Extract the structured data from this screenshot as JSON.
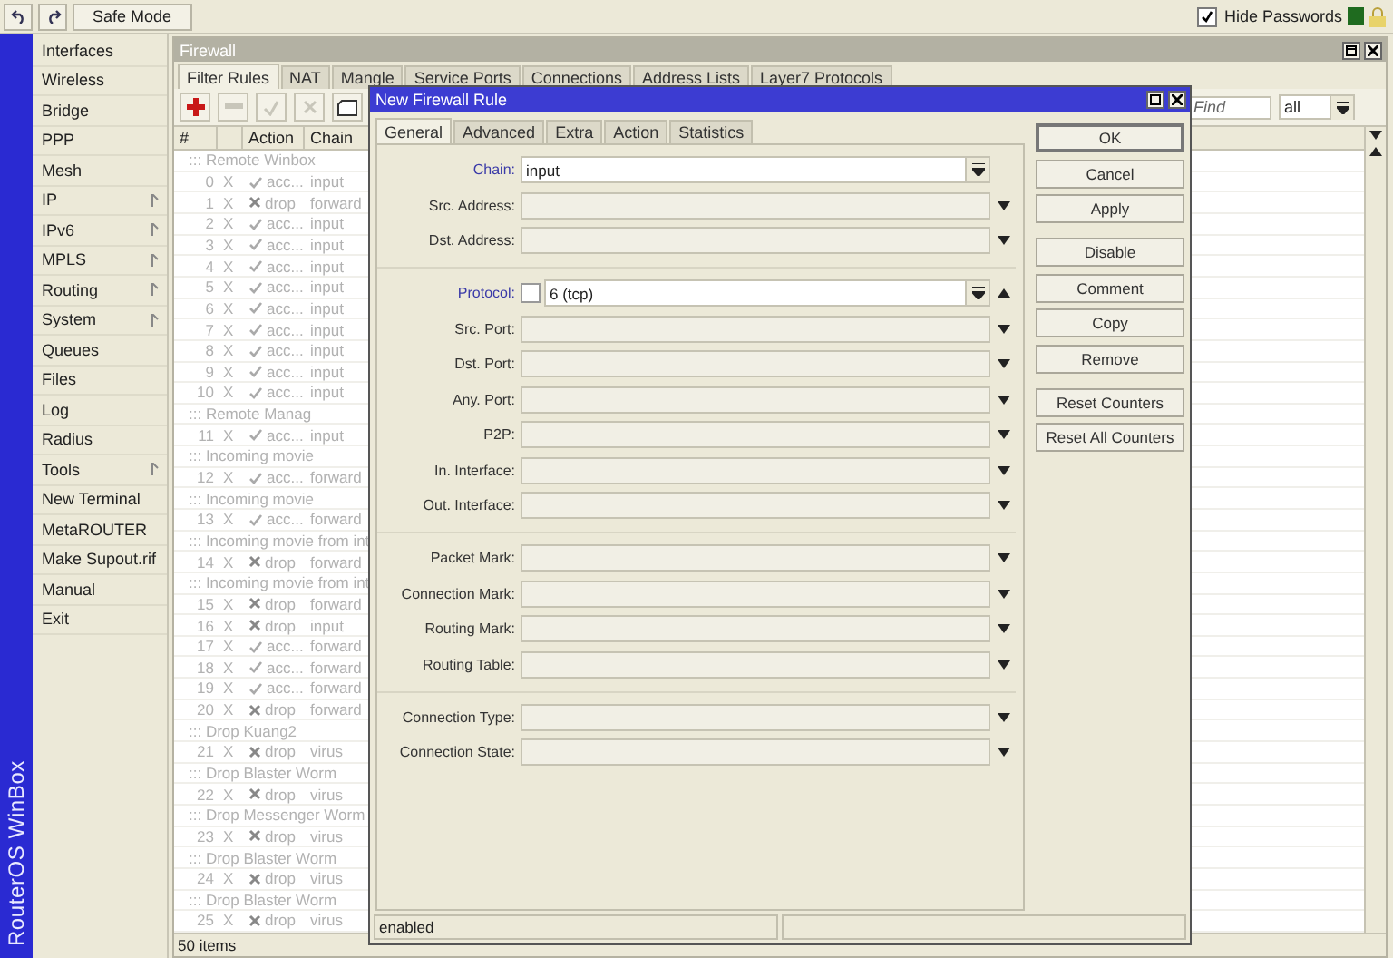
{
  "top_bar": {
    "history_buttons": [
      {
        "kind": "undo"
      },
      {
        "kind": "redo"
      }
    ],
    "safe_mode": "Safe Mode",
    "hide_passwords": {
      "label": "Hide Passwords",
      "checked": true
    }
  },
  "brand": "RouterOS WinBox",
  "menu": [
    {
      "label": "Interfaces",
      "submenu": false
    },
    {
      "label": "Wireless",
      "submenu": false
    },
    {
      "label": "Bridge",
      "submenu": false
    },
    {
      "label": "PPP",
      "submenu": false
    },
    {
      "label": "Mesh",
      "submenu": false
    },
    {
      "label": "IP",
      "submenu": true
    },
    {
      "label": "IPv6",
      "submenu": true
    },
    {
      "label": "MPLS",
      "submenu": true
    },
    {
      "label": "Routing",
      "submenu": true
    },
    {
      "label": "System",
      "submenu": true
    },
    {
      "label": "Queues",
      "submenu": false
    },
    {
      "label": "Files",
      "submenu": false
    },
    {
      "label": "Log",
      "submenu": false
    },
    {
      "label": "Radius",
      "submenu": false
    },
    {
      "label": "Tools",
      "submenu": true
    },
    {
      "label": "New Terminal",
      "submenu": false
    },
    {
      "label": "MetaROUTER",
      "submenu": false
    },
    {
      "label": "Make Supout.rif",
      "submenu": false
    },
    {
      "label": "Manual",
      "submenu": false
    },
    {
      "label": "Exit",
      "submenu": false
    }
  ],
  "firewall": {
    "title": "Firewall",
    "tabs": [
      {
        "label": "Filter Rules",
        "selected": true
      },
      {
        "label": "NAT",
        "selected": false
      },
      {
        "label": "Mangle",
        "selected": false
      },
      {
        "label": "Service Ports",
        "selected": false
      },
      {
        "label": "Connections",
        "selected": false
      },
      {
        "label": "Address Lists",
        "selected": false
      },
      {
        "label": "Layer7 Protocols",
        "selected": false
      }
    ],
    "tools": [
      {
        "kind": "add",
        "disabled": false
      },
      {
        "kind": "remove",
        "disabled": true
      },
      {
        "kind": "enable",
        "disabled": true
      },
      {
        "kind": "disable",
        "disabled": true
      },
      {
        "kind": "comment",
        "disabled": false
      }
    ],
    "find": {
      "placeholder": "Find"
    },
    "filter": {
      "value": "all"
    },
    "columns": [
      "#",
      "Action",
      "Chain"
    ],
    "rows": [
      {
        "kind": "comment",
        "text": "::: Remote Winbox"
      },
      {
        "kind": "accept",
        "number": "0",
        "flag": "X",
        "action": "acc...",
        "chain": "input",
        "disabled": true
      },
      {
        "kind": "drop",
        "number": "1",
        "flag": "X",
        "action": "drop",
        "chain": "forward",
        "disabled": true
      },
      {
        "kind": "accept",
        "number": "2",
        "flag": "X",
        "action": "acc...",
        "chain": "input",
        "disabled": true
      },
      {
        "kind": "accept",
        "number": "3",
        "flag": "X",
        "action": "acc...",
        "chain": "input",
        "disabled": true
      },
      {
        "kind": "accept",
        "number": "4",
        "flag": "X",
        "action": "acc...",
        "chain": "input",
        "disabled": true
      },
      {
        "kind": "accept",
        "number": "5",
        "flag": "X",
        "action": "acc...",
        "chain": "input",
        "disabled": true
      },
      {
        "kind": "accept",
        "number": "6",
        "flag": "X",
        "action": "acc...",
        "chain": "input",
        "disabled": true
      },
      {
        "kind": "accept",
        "number": "7",
        "flag": "X",
        "action": "acc...",
        "chain": "input",
        "disabled": true
      },
      {
        "kind": "accept",
        "number": "8",
        "flag": "X",
        "action": "acc...",
        "chain": "input",
        "disabled": true
      },
      {
        "kind": "accept",
        "number": "9",
        "flag": "X",
        "action": "acc...",
        "chain": "input",
        "disabled": true
      },
      {
        "kind": "accept",
        "number": "10",
        "flag": "X",
        "action": "acc...",
        "chain": "input",
        "disabled": true
      },
      {
        "kind": "comment",
        "text": "::: Remote Manag"
      },
      {
        "kind": "accept",
        "number": "11",
        "flag": "X",
        "action": "acc...",
        "chain": "input",
        "disabled": true
      },
      {
        "kind": "comment",
        "text": "::: Incoming movie"
      },
      {
        "kind": "accept",
        "number": "12",
        "flag": "X",
        "action": "acc...",
        "chain": "forward",
        "disabled": true
      },
      {
        "kind": "comment",
        "text": "::: Incoming movie"
      },
      {
        "kind": "accept",
        "number": "13",
        "flag": "X",
        "action": "acc...",
        "chain": "forward",
        "disabled": true
      },
      {
        "kind": "comment",
        "text": "::: Incoming movie from int"
      },
      {
        "kind": "drop",
        "number": "14",
        "flag": "X",
        "action": "drop",
        "chain": "forward",
        "disabled": true
      },
      {
        "kind": "comment",
        "text": "::: Incoming movie from int"
      },
      {
        "kind": "drop",
        "number": "15",
        "flag": "X",
        "action": "drop",
        "chain": "forward",
        "disabled": true
      },
      {
        "kind": "drop",
        "number": "16",
        "flag": "X",
        "action": "drop",
        "chain": "input",
        "disabled": true
      },
      {
        "kind": "accept",
        "number": "17",
        "flag": "X",
        "action": "acc...",
        "chain": "forward",
        "disabled": true
      },
      {
        "kind": "accept",
        "number": "18",
        "flag": "X",
        "action": "acc...",
        "chain": "forward",
        "disabled": true
      },
      {
        "kind": "accept",
        "number": "19",
        "flag": "X",
        "action": "acc...",
        "chain": "forward",
        "disabled": true
      },
      {
        "kind": "drop",
        "number": "20",
        "flag": "X",
        "action": "drop",
        "chain": "forward",
        "disabled": true
      },
      {
        "kind": "comment",
        "text": "::: Drop Kuang2"
      },
      {
        "kind": "drop",
        "number": "21",
        "flag": "X",
        "action": "drop",
        "chain": "virus",
        "disabled": true
      },
      {
        "kind": "comment",
        "text": "::: Drop Blaster Worm"
      },
      {
        "kind": "drop",
        "number": "22",
        "flag": "X",
        "action": "drop",
        "chain": "virus",
        "disabled": true
      },
      {
        "kind": "comment",
        "text": "::: Drop Messenger Worm"
      },
      {
        "kind": "drop",
        "number": "23",
        "flag": "X",
        "action": "drop",
        "chain": "virus",
        "disabled": true
      },
      {
        "kind": "comment",
        "text": "::: Drop Blaster Worm"
      },
      {
        "kind": "drop",
        "number": "24",
        "flag": "X",
        "action": "drop",
        "chain": "virus",
        "disabled": true
      },
      {
        "kind": "comment",
        "text": "::: Drop Blaster Worm"
      },
      {
        "kind": "drop",
        "number": "25",
        "flag": "X",
        "action": "drop",
        "chain": "virus",
        "disabled": true
      }
    ],
    "status": "50 items"
  },
  "dialog": {
    "title": "New Firewall Rule",
    "tabs": [
      {
        "label": "General",
        "selected": true
      },
      {
        "label": "Advanced",
        "selected": false
      },
      {
        "label": "Extra",
        "selected": false
      },
      {
        "label": "Action",
        "selected": false
      },
      {
        "label": "Statistics",
        "selected": false
      }
    ],
    "sections": [
      [
        {
          "kind": "select",
          "label": "Chain:",
          "value": "input",
          "set": true
        },
        {
          "kind": "dropdown",
          "label": "Src. Address:",
          "set": false
        },
        {
          "kind": "dropdown",
          "label": "Dst. Address:",
          "set": false
        }
      ],
      [
        {
          "kind": "negatable",
          "label": "Protocol:",
          "value": "6 (tcp)",
          "set": true,
          "negated": false
        },
        {
          "kind": "dropdown",
          "label": "Src. Port:",
          "set": false
        },
        {
          "kind": "dropdown",
          "label": "Dst. Port:",
          "set": false
        },
        {
          "kind": "dropdown",
          "label": "Any. Port:",
          "set": false
        },
        {
          "kind": "dropdown",
          "label": "P2P:",
          "set": false
        },
        {
          "kind": "dropdown",
          "label": "In. Interface:",
          "set": false
        },
        {
          "kind": "dropdown",
          "label": "Out. Interface:",
          "set": false
        }
      ],
      [
        {
          "kind": "dropdown",
          "label": "Packet Mark:",
          "set": false
        },
        {
          "kind": "dropdown",
          "label": "Connection Mark:",
          "set": false
        },
        {
          "kind": "dropdown",
          "label": "Routing Mark:",
          "set": false
        },
        {
          "kind": "dropdown",
          "label": "Routing Table:",
          "set": false
        }
      ],
      [
        {
          "kind": "dropdown",
          "label": "Connection Type:",
          "set": false
        },
        {
          "kind": "dropdown",
          "label": "Connection State:",
          "set": false
        }
      ]
    ],
    "button_groups": [
      [
        {
          "label": "OK",
          "default": true
        },
        {
          "label": "Cancel",
          "default": false
        },
        {
          "label": "Apply",
          "default": false
        }
      ],
      [
        {
          "label": "Disable",
          "default": false
        },
        {
          "label": "Comment",
          "default": false
        },
        {
          "label": "Copy",
          "default": false
        },
        {
          "label": "Remove",
          "default": false
        }
      ],
      [
        {
          "label": "Reset Counters",
          "default": false
        },
        {
          "label": "Reset All Counters",
          "default": false
        }
      ]
    ],
    "status": "enabled"
  }
}
